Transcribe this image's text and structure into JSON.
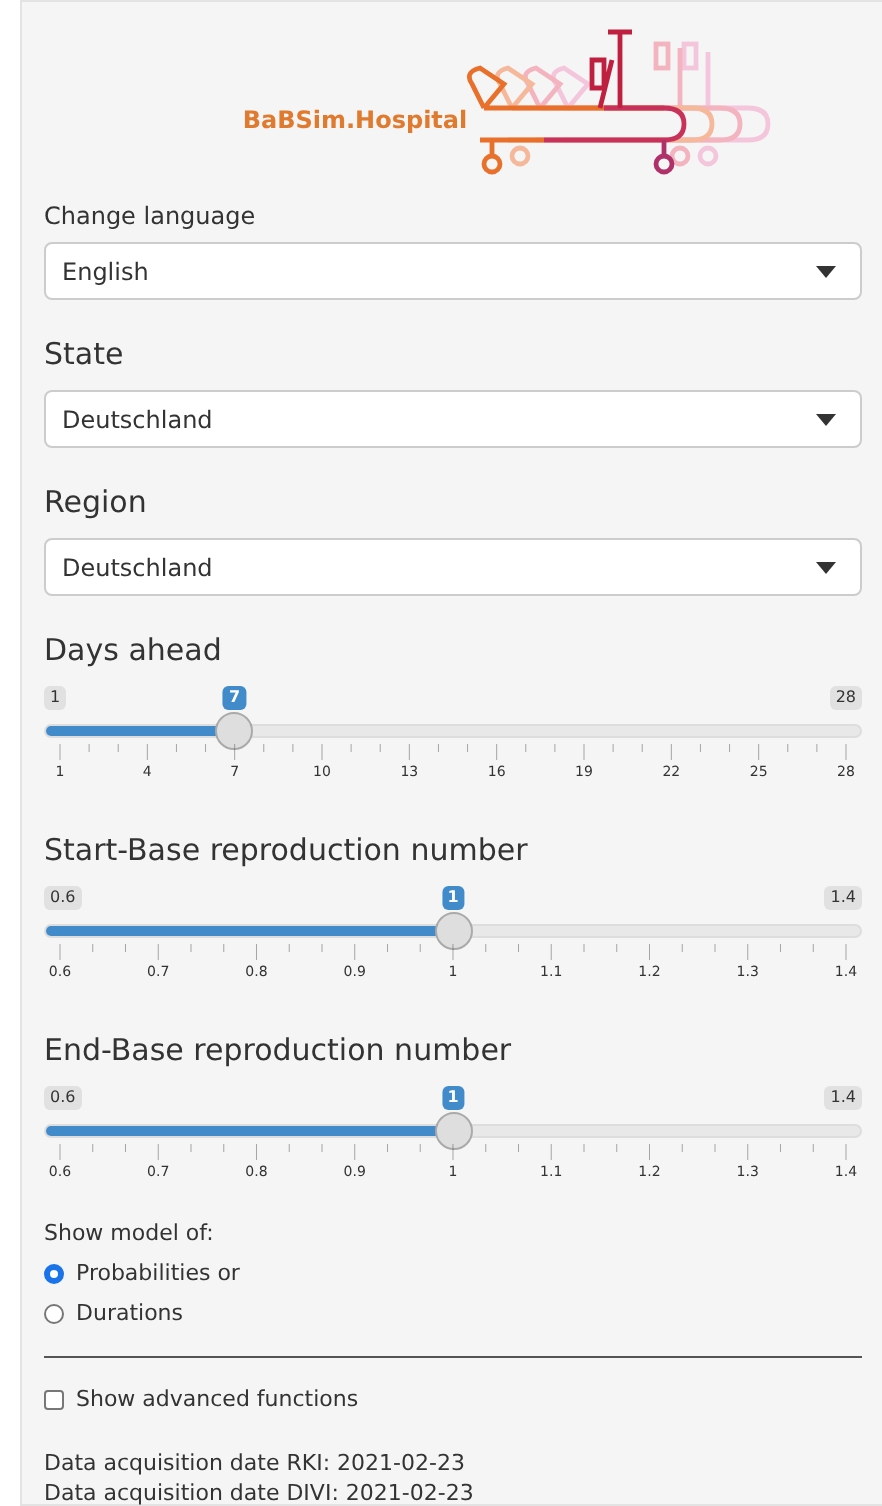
{
  "logo": {
    "text": "BaBSim.Hospital"
  },
  "language": {
    "label": "Change language",
    "value": "English"
  },
  "state": {
    "label": "State",
    "value": "Deutschland"
  },
  "region": {
    "label": "Region",
    "value": "Deutschland"
  },
  "sliders": [
    {
      "label": "Days ahead",
      "min": "1",
      "max": "28",
      "value": "7",
      "level": 0.2222,
      "ticks": [
        "1",
        "4",
        "7",
        "10",
        "13",
        "16",
        "19",
        "22",
        "25",
        "28"
      ]
    },
    {
      "label": "Start-Base reproduction number",
      "min": "0.6",
      "max": "1.4",
      "value": "1",
      "level": 0.5,
      "ticks": [
        "0.6",
        "0.7",
        "0.8",
        "0.9",
        "1",
        "1.1",
        "1.2",
        "1.3",
        "1.4"
      ]
    },
    {
      "label": "End-Base reproduction number",
      "min": "0.6",
      "max": "1.4",
      "value": "1",
      "level": 0.5,
      "ticks": [
        "0.6",
        "0.7",
        "0.8",
        "0.9",
        "1",
        "1.1",
        "1.2",
        "1.3",
        "1.4"
      ]
    }
  ],
  "model": {
    "label": "Show model of:",
    "options": [
      {
        "label": "Probabilities or",
        "selected": true
      },
      {
        "label": "Durations",
        "selected": false
      }
    ]
  },
  "advanced": {
    "label": "Show advanced functions",
    "checked": false
  },
  "info": [
    "Data acquisition date RKI: 2021-02-23",
    "Data acquisition date DIVI: 2021-02-23"
  ]
}
